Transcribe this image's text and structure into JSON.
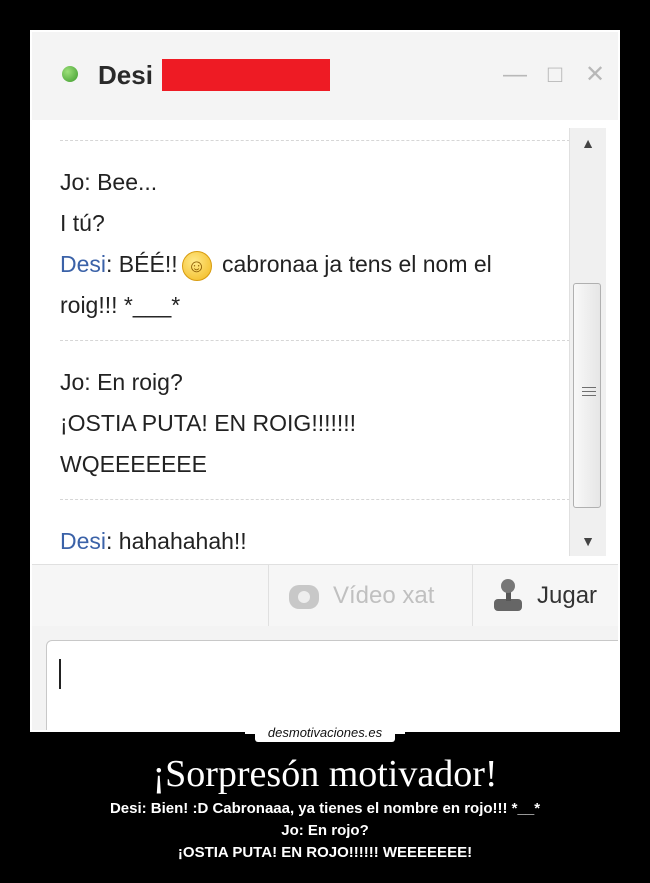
{
  "window": {
    "contact_name": "Desi",
    "buttons": [
      "—",
      "□",
      "✕"
    ]
  },
  "chat": {
    "blocks": [
      {
        "lines": [
          {
            "speaker": "Jo",
            "text": ": Bee..."
          },
          {
            "speaker": "",
            "text": "I tú?"
          },
          {
            "speaker": "Desi",
            "text": ": BÉÉ!!",
            "smiley": "☺",
            "text2": " cabronaa ja tens el nom el"
          },
          {
            "speaker": "",
            "text": "roig!!! *___*"
          }
        ]
      },
      {
        "lines": [
          {
            "speaker": "Jo",
            "text": ": En roig?"
          },
          {
            "speaker": "",
            "text": "¡OSTIA PUTA! EN ROIG!!!!!!!"
          },
          {
            "speaker": "",
            "text": "WQEEEEEEE"
          }
        ]
      },
      {
        "lines": [
          {
            "speaker": "Desi",
            "text": ": hahahahah!!"
          }
        ]
      }
    ]
  },
  "toolbar": {
    "video_label": "Vídeo xat",
    "jugar_label": "Jugar"
  },
  "watermark": "desmotivaciones.es",
  "caption": {
    "title": "¡Sorpresón motivador!",
    "lines": [
      "Desi: Bien! :D Cabronaaa, ya tienes el nombre en rojo!!! *__*",
      "Jo: En rojo?",
      "¡OSTIA PUTA! EN ROJO!!!!!! WEEEEEEE!"
    ]
  }
}
